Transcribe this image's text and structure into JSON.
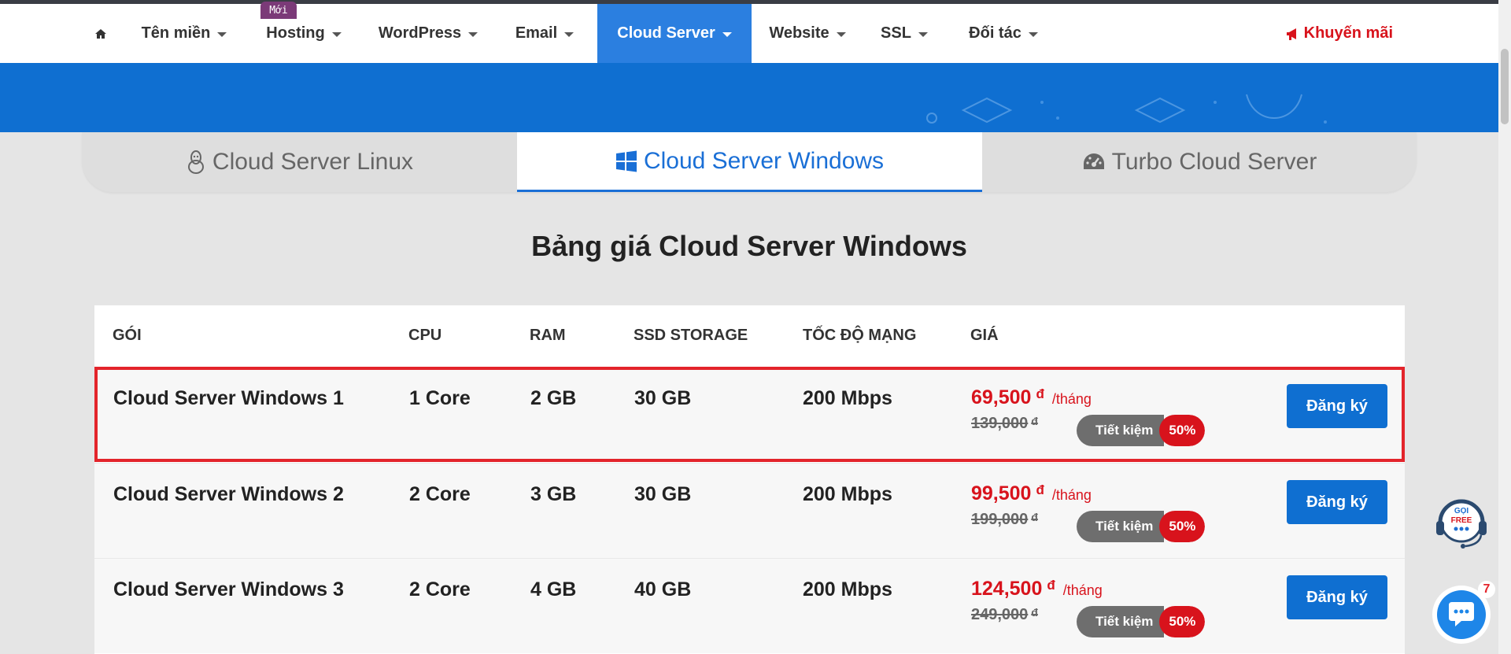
{
  "nav": {
    "items": [
      {
        "label": "Tên miền"
      },
      {
        "label": "Hosting"
      },
      {
        "label": "WordPress"
      },
      {
        "label": "Email"
      },
      {
        "label": "Cloud Server"
      },
      {
        "label": "Website"
      },
      {
        "label": "SSL"
      },
      {
        "label": "Đối tác"
      }
    ],
    "hosting_badge": "Mới",
    "promo": "Khuyến mãi"
  },
  "tabs": [
    {
      "label": "Cloud Server Linux",
      "icon": "linux-icon"
    },
    {
      "label": "Cloud Server Windows",
      "icon": "windows-icon"
    },
    {
      "label": "Turbo Cloud Server",
      "icon": "speedometer-icon"
    }
  ],
  "section_title": "Bảng giá Cloud Server Windows",
  "table": {
    "headers": [
      "GÓI",
      "CPU",
      "RAM",
      "SSD STORAGE",
      "TỐC ĐỘ MẠNG",
      "GIÁ"
    ],
    "rows": [
      {
        "name": "Cloud Server Windows 1",
        "cpu": "1 Core",
        "ram": "2 GB",
        "ssd": "30 GB",
        "speed": "200 Mbps",
        "price": "69,500",
        "currency": "đ",
        "period": "/tháng",
        "old_price": "139,000",
        "save_label": "Tiết kiệm",
        "save_pct": "50%",
        "button": "Đăng ký"
      },
      {
        "name": "Cloud Server Windows 2",
        "cpu": "2 Core",
        "ram": "3 GB",
        "ssd": "30 GB",
        "speed": "200 Mbps",
        "price": "99,500",
        "currency": "đ",
        "period": "/tháng",
        "old_price": "199,000",
        "save_label": "Tiết kiệm",
        "save_pct": "50%",
        "button": "Đăng ký"
      },
      {
        "name": "Cloud Server Windows 3",
        "cpu": "2 Core",
        "ram": "4 GB",
        "ssd": "40 GB",
        "speed": "200 Mbps",
        "price": "124,500",
        "currency": "đ",
        "period": "/tháng",
        "old_price": "249,000",
        "save_label": "Tiết kiệm",
        "save_pct": "50%",
        "button": "Đăng ký"
      }
    ]
  },
  "widgets": {
    "support_text_1": "GỌI",
    "support_text_2": "FREE",
    "chat_count": "7"
  },
  "colors": {
    "primary": "#0f6fd1",
    "accent_red": "#d8131c",
    "highlight_border": "#e3242b"
  }
}
